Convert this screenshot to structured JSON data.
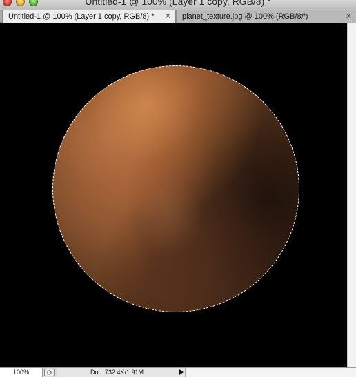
{
  "window": {
    "title": "Untitled-1 @ 100% (Layer 1 copy, RGB/8) *"
  },
  "tabs": [
    {
      "label": "Untitled-1 @ 100% (Layer 1 copy, RGB/8) *",
      "close": "✕",
      "active": true
    },
    {
      "label": "planet_texture.jpg @ 100% (RGB/8#)",
      "close": "✕",
      "active": false
    }
  ],
  "canvas": {
    "background": "#000000",
    "planet_color": "#8a5530"
  },
  "status": {
    "zoom": "100%",
    "doc": "Doc: 732.4K/1.91M"
  }
}
